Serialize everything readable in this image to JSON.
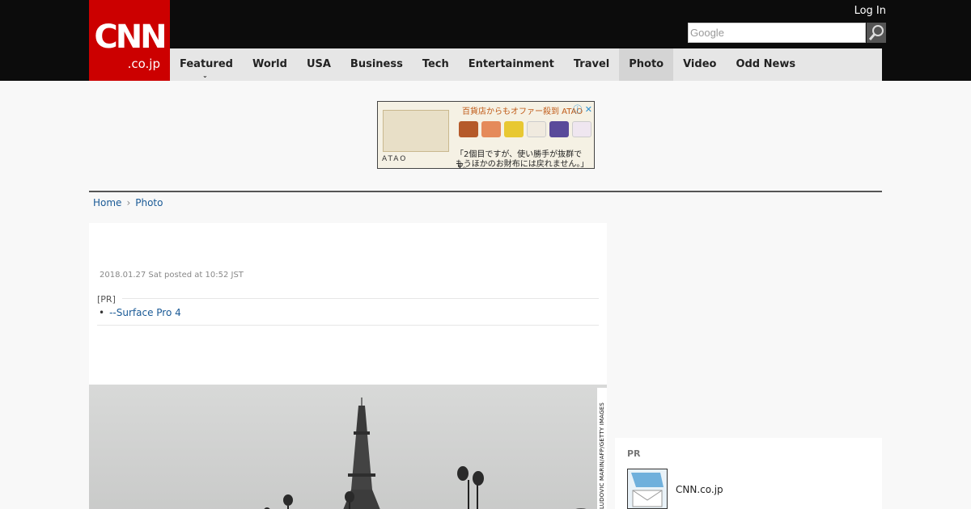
{
  "header": {
    "logo_main": "CNN",
    "logo_sub": ".co.jp",
    "login_label": "Log In",
    "search_placeholder": "Google"
  },
  "nav": {
    "items": [
      {
        "label": "Featured"
      },
      {
        "label": "World"
      },
      {
        "label": "USA"
      },
      {
        "label": "Business"
      },
      {
        "label": "Tech"
      },
      {
        "label": "Entertainment"
      },
      {
        "label": "Travel"
      },
      {
        "label": "Photo",
        "active": true
      },
      {
        "label": "Video"
      },
      {
        "label": "Odd News"
      }
    ]
  },
  "ad": {
    "header": "百貨店からもオファー殺到 ATAO",
    "line1": "「2個目ですが、使い勝手が抜群です。",
    "line2": "もうほかのお財布には戻れません。」",
    "brand": "ATAO"
  },
  "breadcrumb": {
    "home": "Home",
    "current": "Photo"
  },
  "article": {
    "date": "2018.01.27 Sat posted at 10:52 JST",
    "pr_label": "[PR]",
    "pr_link": "--Surface Pro 4",
    "photo_credit": "LUDOVIC MARIN/AFP/GETTY IMAGES"
  },
  "sidebar": {
    "pr_title": "PR",
    "pr_item": "CNN.co.jp"
  },
  "colors": {
    "brand_red": "#cc0000",
    "link": "#1a5a96",
    "topbar": "#0c0c0c"
  }
}
